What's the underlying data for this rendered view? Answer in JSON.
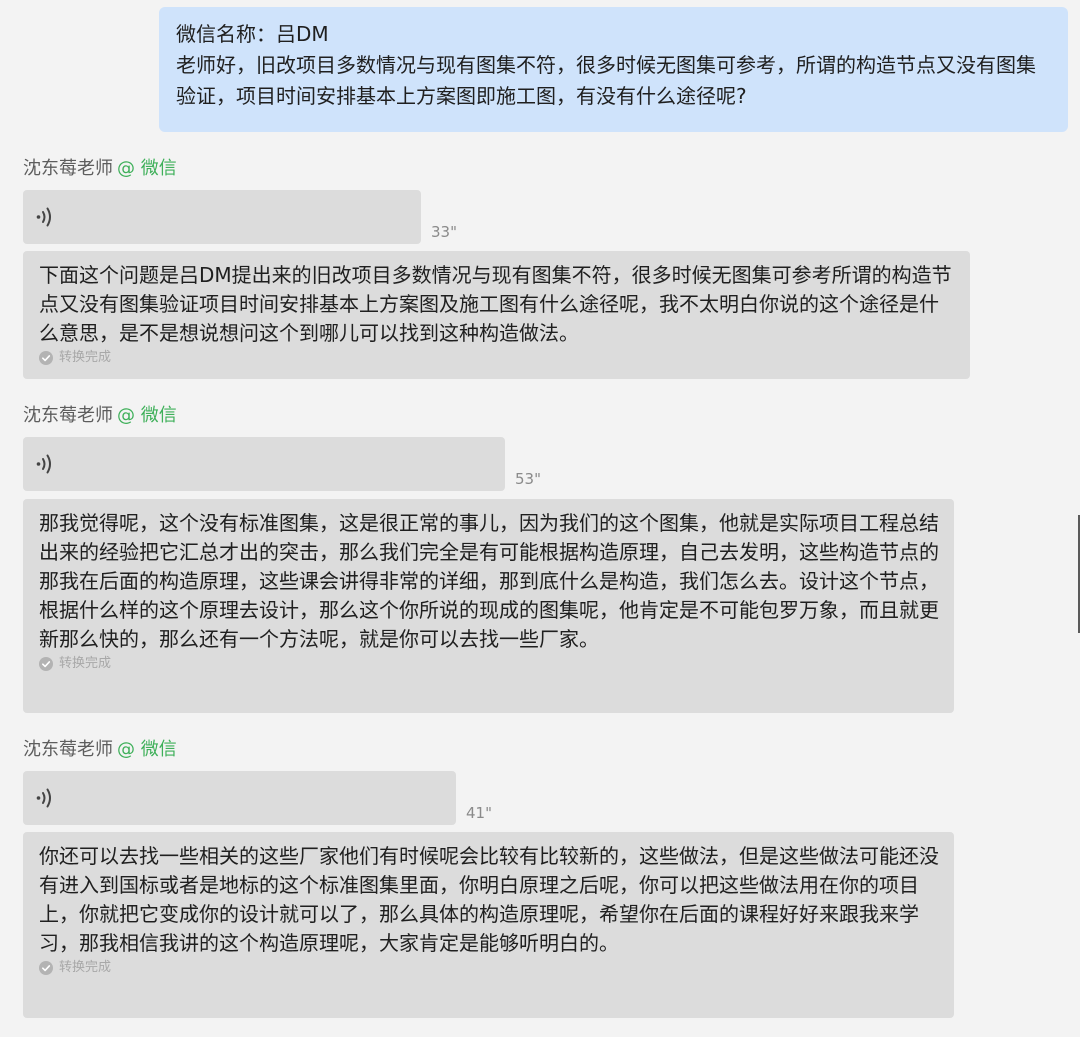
{
  "question": {
    "sender_line": "微信名称：吕DM",
    "text": "老师好，旧改项目多数情况与现有图集不符，很多时候无图集可参考，所谓的构造节点又没有图集验证，项目时间安排基本上方案图即施工图，有没有什么途径呢?"
  },
  "messages": [
    {
      "sender": "沈东莓老师",
      "channel": "@ 微信",
      "voice_icon": "voice-wave-icon",
      "duration": "33\"",
      "transcript": "下面这个问题是吕DM提出来的旧改项目多数情况与现有图集不符，很多时候无图集可参考所谓的构造节点又没有图集验证项目时间安排基本上方案图及施工图有什么途径呢，我不太明白你说的这个途径是什么意思，是不是想说想问这个到哪儿可以找到这种构造做法。",
      "status_icon": "check-circle-icon",
      "status": "转换完成"
    },
    {
      "sender": "沈东莓老师",
      "channel": "@ 微信",
      "voice_icon": "voice-wave-icon",
      "duration": "53\"",
      "transcript": "那我觉得呢，这个没有标准图集，这是很正常的事儿，因为我们的这个图集，他就是实际项目工程总结出来的经验把它汇总才出的突击，那么我们完全是有可能根据构造原理，自己去发明，这些构造节点的那我在后面的构造原理，这些课会讲得非常的详细，那到底什么是构造，我们怎么去。设计这个节点，根据什么样的这个原理去设计，那么这个你所说的现成的图集呢，他肯定是不可能包罗万象，而且就更新那么快的，那么还有一个方法呢，就是你可以去找一些厂家。",
      "status_icon": "check-circle-icon",
      "status": "转换完成"
    },
    {
      "sender": "沈东莓老师",
      "channel": "@ 微信",
      "voice_icon": "voice-wave-icon",
      "duration": "41\"",
      "transcript": "你还可以去找一些相关的这些厂家他们有时候呢会比较有比较新的，这些做法，但是这些做法可能还没有进入到国标或者是地标的这个标准图集里面，你明白原理之后呢，你可以把这些做法用在你的项目上，你就把它变成你的设计就可以了，那么具体的构造原理呢，希望你在后面的课程好好来跟我来学习，那我相信我讲的这个构造原理呢，大家肯定是能够听明白的。",
      "status_icon": "check-circle-icon",
      "status": "转换完成"
    }
  ],
  "colors": {
    "question_bg": "#cfe3fb",
    "bubble_bg": "#dcdcdc",
    "channel_green": "#3fb05a",
    "page_bg": "#f3f3f3"
  }
}
